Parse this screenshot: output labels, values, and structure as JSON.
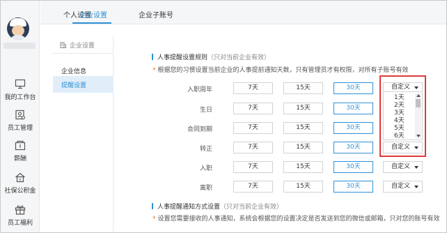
{
  "top_tabs": [
    {
      "label": "个人设置",
      "active": false
    },
    {
      "label": "企业设置",
      "active": true
    },
    {
      "label": "企业子账号",
      "active": false
    }
  ],
  "left_nav": [
    {
      "label": "我的工作台",
      "icon": "monitor-icon"
    },
    {
      "label": "员工管理",
      "icon": "employee-icon"
    },
    {
      "label": "薪酬",
      "icon": "wallet-icon"
    },
    {
      "label": "社保公积金",
      "icon": "house-icon"
    },
    {
      "label": "员工福利",
      "icon": "gift-icon"
    }
  ],
  "subnav": {
    "header": "企业设置",
    "items": [
      {
        "label": "企业信息",
        "active": false
      },
      {
        "label": "提醒设置",
        "active": true
      }
    ]
  },
  "reminder_section": {
    "title": "人事提醒设置规则",
    "hint": "（只对当前企业有效）",
    "note": "根据您的习惯设置当前企业的人事提前通知天数，只有管理员才有权限，对所有子账号有效",
    "options": [
      "7天",
      "15天",
      "30天"
    ],
    "custom_label": "自定义",
    "rows": [
      {
        "label": "入职周年",
        "selected": "30天"
      },
      {
        "label": "生日",
        "selected": "30天"
      },
      {
        "label": "合同到期",
        "selected": "30天"
      },
      {
        "label": "转正",
        "selected": "30天"
      },
      {
        "label": "入职",
        "selected": "30天"
      },
      {
        "label": "离职",
        "selected": "30天"
      }
    ]
  },
  "custom_dropdown": {
    "items": [
      "1天",
      "2天",
      "3天",
      "4天",
      "5天",
      "6天"
    ]
  },
  "notify_section": {
    "title": "人事提醒通知方式设置",
    "hint": "（只对当前企业有效）",
    "note": "设置您需要接收的人事通知，系统会根据您的设置决定是否发送到您的微信或邮箱，只对您的账号有效"
  },
  "colors": {
    "accent": "#2f90d6",
    "highlight_border": "#e03a3a",
    "note_star": "#e0782b"
  }
}
